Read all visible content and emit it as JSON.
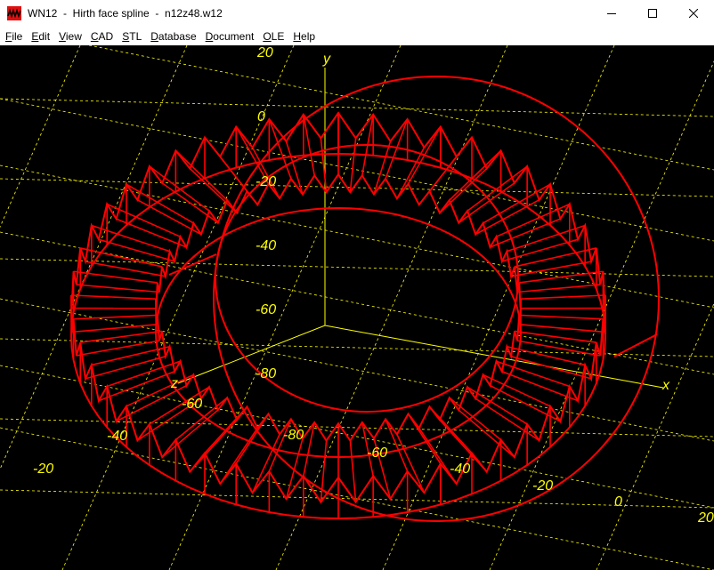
{
  "window": {
    "title": "WN12  -  Hirth face spline  -  n12z48.w12",
    "minimize_icon": "minimize-icon",
    "maximize_icon": "maximize-icon",
    "close_icon": "close-icon"
  },
  "menu": [
    {
      "label": "File",
      "underline": "F",
      "rest": "ile"
    },
    {
      "label": "Edit",
      "underline": "E",
      "rest": "dit"
    },
    {
      "label": "View",
      "underline": "V",
      "rest": "iew"
    },
    {
      "label": "CAD",
      "underline": "C",
      "rest": "AD"
    },
    {
      "label": "STL",
      "underline": "S",
      "rest": "TL"
    },
    {
      "label": "Database",
      "underline": "D",
      "rest": "atabase"
    },
    {
      "label": "Document",
      "underline": "D",
      "rest": "ocument"
    },
    {
      "label": "OLE",
      "underline": "O",
      "rest": "LE"
    },
    {
      "label": "Help",
      "underline": "H",
      "rest": "elp"
    }
  ],
  "plot": {
    "axis_x_name": "x",
    "axis_y_name": "y",
    "axis_z_name": "z",
    "labels": [
      "20",
      "0",
      "-20",
      "-40",
      "-60",
      "-80",
      "-60",
      "-40",
      "-20",
      "0",
      "20",
      "-60",
      "-40",
      "-20",
      "z"
    ],
    "colors": {
      "grid": "#ffff00",
      "part": "#ff0000",
      "background": "#000000"
    },
    "teeth": 48
  }
}
